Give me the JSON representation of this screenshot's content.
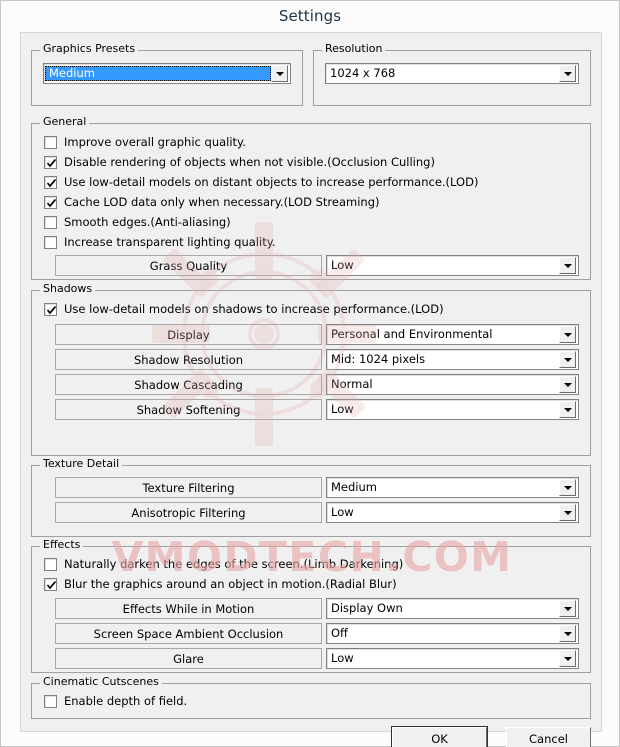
{
  "window": {
    "title": "Settings"
  },
  "watermark": {
    "text": "VMODTECH.COM"
  },
  "graphics_presets": {
    "legend": "Graphics Presets",
    "combo": {
      "value": "Medium",
      "selected": true
    }
  },
  "resolution": {
    "legend": "Resolution",
    "combo": {
      "value": "1024 x 768"
    }
  },
  "general": {
    "legend": "General",
    "checks": [
      {
        "label": "Improve overall graphic quality.",
        "checked": false
      },
      {
        "label": "Disable rendering of objects when not visible.(Occlusion Culling)",
        "checked": true
      },
      {
        "label": "Use low-detail models on distant objects to increase performance.(LOD)",
        "checked": true
      },
      {
        "label": "Cache LOD data only when necessary.(LOD Streaming)",
        "checked": true
      },
      {
        "label": "Smooth edges.(Anti-aliasing)",
        "checked": false
      },
      {
        "label": "Increase transparent lighting quality.",
        "checked": false
      }
    ],
    "rows": [
      {
        "label": "Grass Quality",
        "value": "Low"
      }
    ]
  },
  "shadows": {
    "legend": "Shadows",
    "checks": [
      {
        "label": "Use low-detail models on shadows to increase performance.(LOD)",
        "checked": true
      }
    ],
    "rows": [
      {
        "label": "Display",
        "value": "Personal and Environmental"
      },
      {
        "label": "Shadow Resolution",
        "value": "Mid: 1024 pixels"
      },
      {
        "label": "Shadow Cascading",
        "value": "Normal"
      },
      {
        "label": "Shadow Softening",
        "value": "Low"
      }
    ]
  },
  "texture_detail": {
    "legend": "Texture Detail",
    "rows": [
      {
        "label": "Texture Filtering",
        "value": "Medium"
      },
      {
        "label": "Anisotropic Filtering",
        "value": "Low"
      }
    ]
  },
  "effects": {
    "legend": "Effects",
    "checks": [
      {
        "label": "Naturally darken the edges of the screen.(Limb Darkening)",
        "checked": false
      },
      {
        "label": "Blur the graphics around an object in motion.(Radial Blur)",
        "checked": true
      }
    ],
    "rows": [
      {
        "label": "Effects While in Motion",
        "value": "Display Own"
      },
      {
        "label": "Screen Space Ambient Occlusion",
        "value": "Off"
      },
      {
        "label": "Glare",
        "value": "Low"
      }
    ]
  },
  "cinematic_cutscenes": {
    "legend": "Cinematic Cutscenes",
    "checks": [
      {
        "label": "Enable depth of field.",
        "checked": false
      }
    ]
  },
  "buttons": {
    "ok": "OK",
    "cancel": "Cancel"
  },
  "colors": {
    "selection_blue": "#3399ff",
    "dialog_face": "#f0f0f0",
    "title_text": "#1f3348",
    "watermark_red": "#e8a6a6"
  }
}
